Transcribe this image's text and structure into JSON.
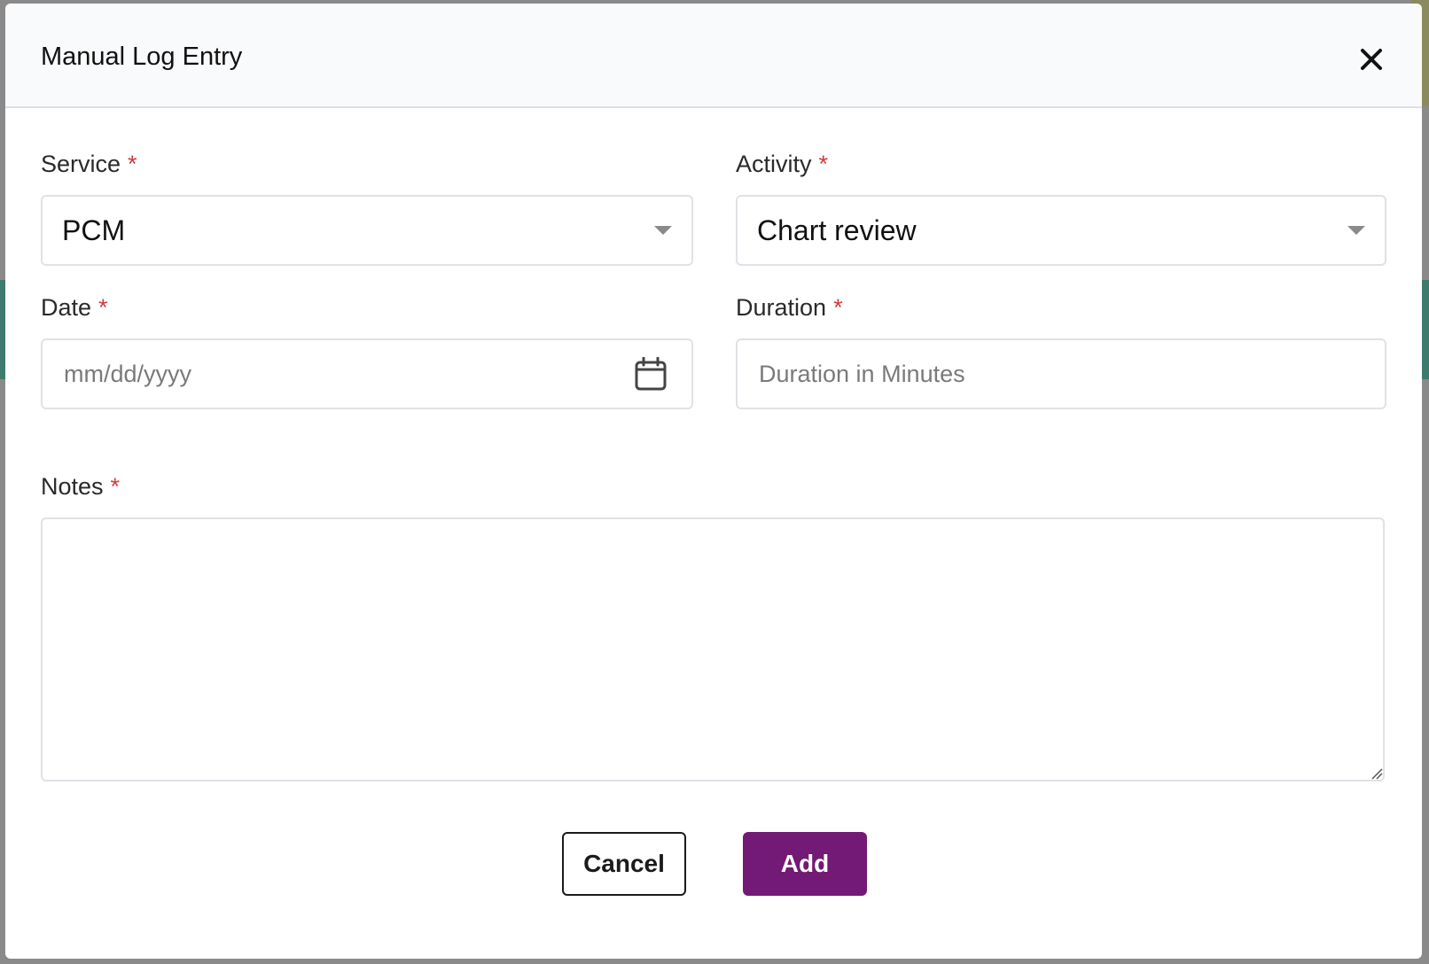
{
  "dialog": {
    "title": "Manual Log Entry",
    "close_icon": "close-icon"
  },
  "form": {
    "service": {
      "label": "Service",
      "required_mark": "*",
      "value": "PCM",
      "icon": "chevron-down-icon"
    },
    "activity": {
      "label": "Activity",
      "required_mark": "*",
      "value": "Chart review",
      "icon": "chevron-down-icon"
    },
    "date": {
      "label": "Date",
      "required_mark": "*",
      "placeholder": "mm/dd/yyyy",
      "icon": "calendar-icon"
    },
    "duration": {
      "label": "Duration",
      "required_mark": "*",
      "placeholder": "Duration in Minutes"
    },
    "notes": {
      "label": "Notes",
      "required_mark": "*",
      "value": ""
    }
  },
  "actions": {
    "cancel_label": "Cancel",
    "add_label": "Add"
  },
  "colors": {
    "primary": "#721a75",
    "required": "#d13b3b",
    "border": "#dfe2e6"
  }
}
